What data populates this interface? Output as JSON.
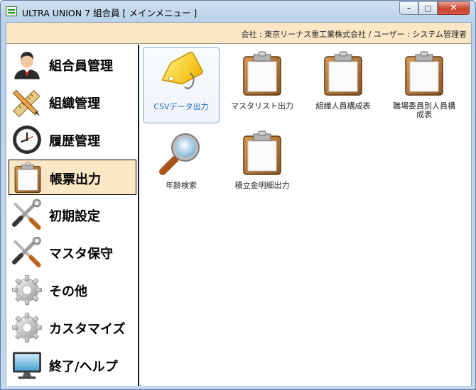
{
  "window": {
    "title": "ULTRA UNION 7 組合員 [ メインメニュー ]",
    "controls": {
      "minimize": "–",
      "maximize": "□",
      "close": "✕"
    }
  },
  "header": {
    "company_info": "会社 : 東京リーナス重工業株式会社 / ユーザー : システム管理者"
  },
  "sidebar": {
    "items": [
      {
        "label": "組合員管理",
        "icon": "member-person-icon"
      },
      {
        "label": "組織管理",
        "icon": "ruler-pencil-icon"
      },
      {
        "label": "履歴管理",
        "icon": "clock-icon"
      },
      {
        "label": "帳票出力",
        "icon": "clipboard-icon",
        "selected": true
      },
      {
        "label": "初期設定",
        "icon": "wrench-screwdriver-icon"
      },
      {
        "label": "マスタ保守",
        "icon": "wrench-screwdriver-icon"
      },
      {
        "label": "その他",
        "icon": "gear-icon"
      },
      {
        "label": "カスタマイズ",
        "icon": "gear-icon"
      },
      {
        "label": "終了/ヘルプ",
        "icon": "monitor-icon"
      }
    ]
  },
  "main": {
    "tiles": [
      {
        "label": "CSVデータ出力",
        "icon": "tag-icon",
        "selected": true
      },
      {
        "label": "マスタリスト出力",
        "icon": "clipboard-icon"
      },
      {
        "label": "組織人員構成表",
        "icon": "clipboard-icon"
      },
      {
        "label": "職場委員別人員構成表",
        "icon": "clipboard-icon"
      },
      {
        "label": "年齢検索",
        "icon": "magnifier-icon"
      },
      {
        "label": "積立金明細出力",
        "icon": "clipboard-icon"
      }
    ]
  },
  "colors": {
    "header_bg": "#fbe7c6",
    "selection_bg": "#fbe6c6",
    "tile_selected_text": "#1c64b8",
    "window_frame": "#b9d1ea"
  }
}
